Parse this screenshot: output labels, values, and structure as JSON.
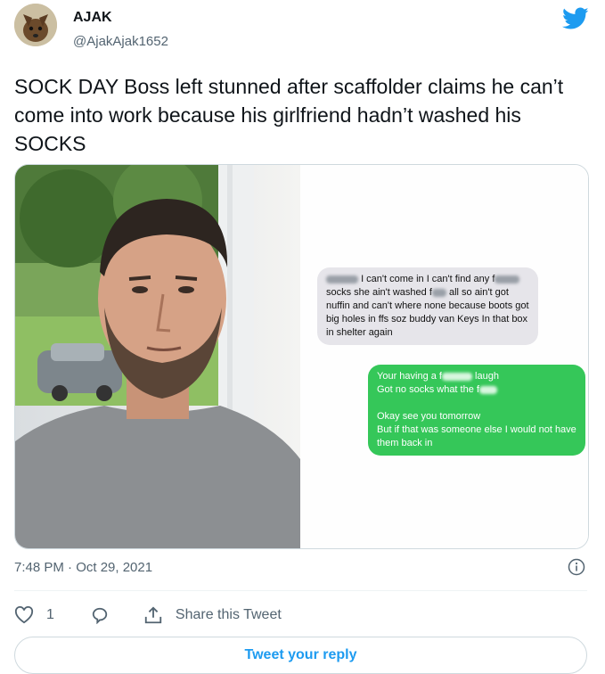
{
  "author": {
    "name": "AJAK",
    "handle": "@AjakAjak1652"
  },
  "tweet": {
    "text": "SOCK DAY Boss left stunned after scaffolder claims he can’t come into work because his girlfriend hadn’t washed his SOCKS",
    "timestamp": "7:48 PM · Oct 29, 2021"
  },
  "messages": {
    "incoming": {
      "seg1": "I can't come in I can't find any",
      "seg2": "f",
      "seg3": "socks she ain't washed f",
      "seg4": "all so ain't got nuffin and can't where none because boots got big holes in ffs soz buddy van Keys In that box in shelter again"
    },
    "outgoing": {
      "line1a": "Your having a f",
      "line1b": "laugh",
      "line2a": "Got no socks what the f",
      "line3": "Okay see you tomorrow",
      "line4": "But if that was someone else I would not  have them back in"
    }
  },
  "actions": {
    "like_count": "1",
    "share_label": "Share this Tweet",
    "reply_button_label": "Tweet your reply"
  },
  "colors": {
    "accent": "#1d9bf0",
    "bubble_green": "#35c759",
    "bubble_gray": "#e6e5ea"
  },
  "icons": [
    "avatar",
    "twitter-bird-icon",
    "info-icon",
    "heart-icon",
    "reply-icon",
    "share-icon"
  ]
}
